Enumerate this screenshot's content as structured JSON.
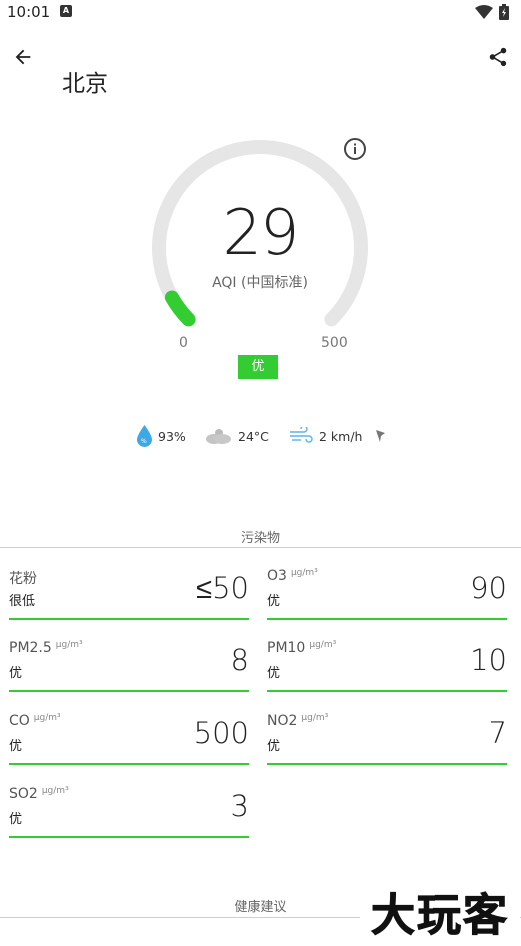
{
  "status_bar": {
    "time": "10:01",
    "notification_icon": "a-notification-icon",
    "wifi_icon": "wifi-icon",
    "battery_icon": "battery-icon"
  },
  "header": {
    "back_icon": "arrow-back-icon",
    "city": "北京",
    "share_icon": "share-icon"
  },
  "gauge": {
    "aqi": "29",
    "label": "AQI (中国标准)",
    "min": "0",
    "max": "500",
    "level": "优",
    "fraction": 0.058,
    "accent": "#33cc33",
    "track_color": "#e6e6e6",
    "info_icon": "info-icon"
  },
  "weather": {
    "humidity": "93%",
    "temperature": "24°C",
    "wind": "2 km/h"
  },
  "pollutants": {
    "section_title": "污染物",
    "items": [
      {
        "name": "花粉",
        "unit": "",
        "level": "很低",
        "value": "≤50"
      },
      {
        "name": "O3",
        "unit": "μg/m³",
        "level": "优",
        "value": "90"
      },
      {
        "name": "PM2.5",
        "unit": "μg/m³",
        "level": "优",
        "value": "8"
      },
      {
        "name": "PM10",
        "unit": "μg/m³",
        "level": "优",
        "value": "10"
      },
      {
        "name": "CO",
        "unit": "μg/m³",
        "level": "优",
        "value": "500"
      },
      {
        "name": "NO2",
        "unit": "μg/m³",
        "level": "优",
        "value": "7"
      },
      {
        "name": "SO2",
        "unit": "μg/m³",
        "level": "优",
        "value": "3"
      }
    ]
  },
  "health": {
    "section_title": "健康建议"
  },
  "watermark": {
    "text": "大玩客"
  }
}
